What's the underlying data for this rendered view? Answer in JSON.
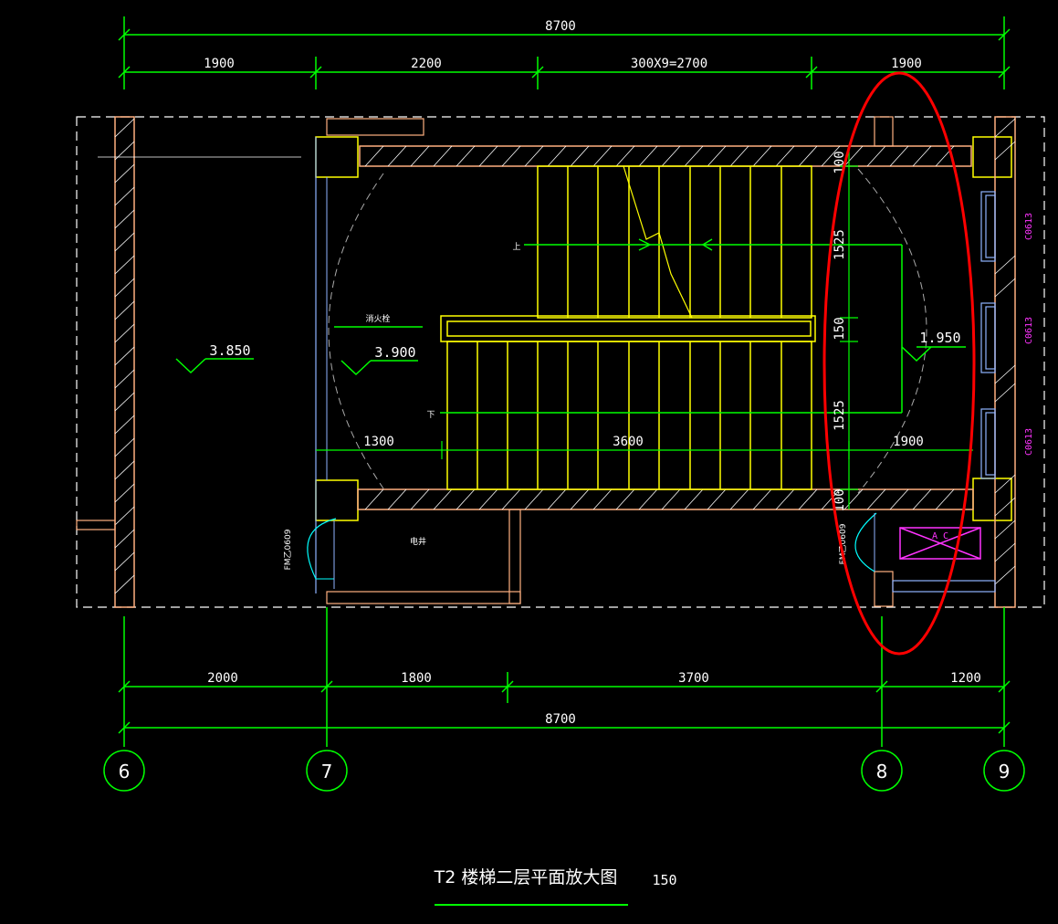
{
  "top_dims": {
    "total": "8700",
    "seg1": "1900",
    "seg2": "2200",
    "seg3": "300X9=2700",
    "seg4": "1900"
  },
  "bottom_dims": {
    "seg1": "2000",
    "seg2": "1800",
    "seg3": "3700",
    "seg4": "1200",
    "total": "8700"
  },
  "right_dims": {
    "v1": "100",
    "v2": "1525",
    "v3": "150",
    "v4": "1525",
    "v5": "100"
  },
  "inner_dims": {
    "d1": "1300",
    "d2": "3600",
    "d3": "1900"
  },
  "levels": {
    "left": "3.850",
    "middle": "3.900",
    "right": "1.950"
  },
  "axes": [
    "6",
    "7",
    "8",
    "9"
  ],
  "windows": [
    "C0613",
    "C0613",
    "C0613"
  ],
  "labels": {
    "up": "上",
    "down": "下",
    "fire_hydrant": "消火栓",
    "room": "电井",
    "door_left": "FM乙0609",
    "door_right": "FM乙0609",
    "ac": "A  C"
  },
  "title": {
    "text": "T2 楼梯二层平面放大图",
    "scale": "150"
  },
  "colors": {
    "background": "#000000",
    "dimension_lines": "#00ff00",
    "stairs": "#ffff00",
    "walls": "#ffb080",
    "windows": "#ff33ff",
    "highlight": "#ff0000",
    "doors": "#00ffff"
  }
}
